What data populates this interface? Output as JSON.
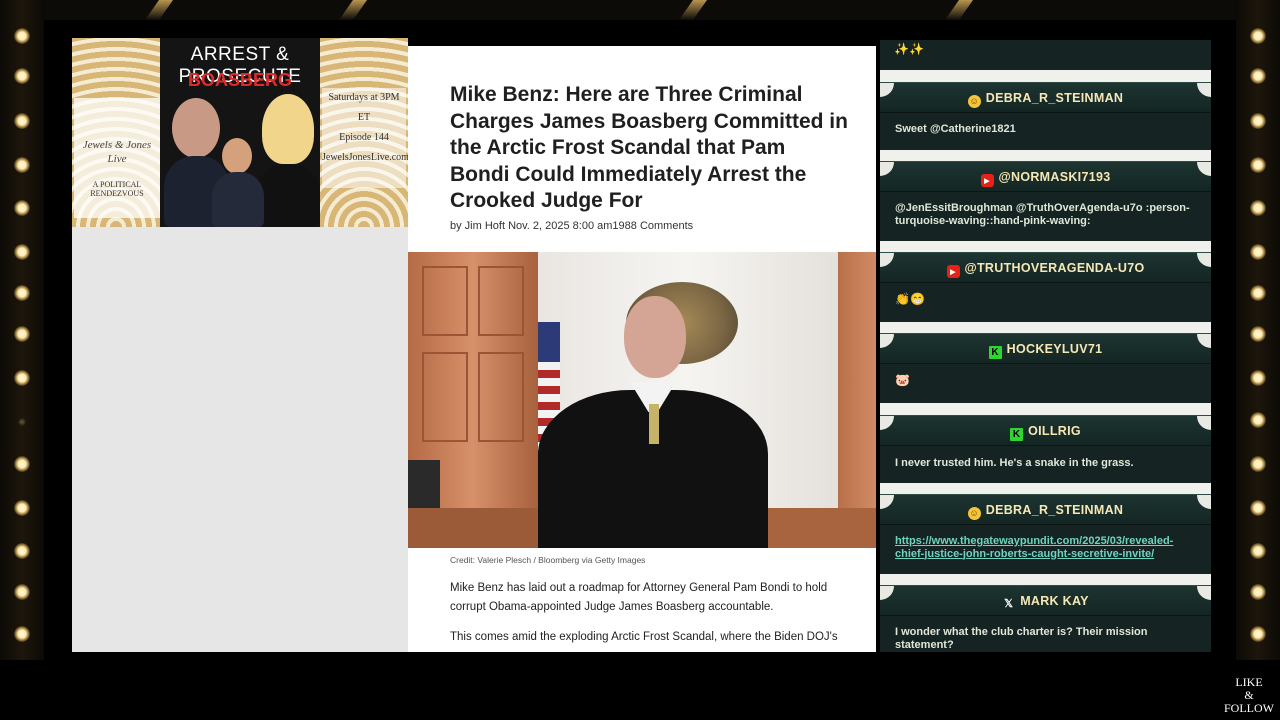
{
  "promo": {
    "title_line1": "ARREST & PROSECUTE",
    "title_line2": "BOASBERG",
    "brand": "Jewels & Jones Live",
    "brand_tagline": "A POLITICAL RENDEZVOUS",
    "schedule": [
      "Saturdays at 3PM ET",
      "Episode 144",
      "JewelsJonesLive.com"
    ]
  },
  "article": {
    "headline": "Mike Benz: Here are Three Criminal Charges James Boasberg Committed in the Arctic Frost Scandal that Pam Bondi Could Immediately Arrest the Crooked Judge For",
    "byline": "by Jim Hoft Nov. 2, 2025 8:00 am1988 Comments",
    "caption": "Credit: Valerie Plesch / Bloomberg via Getty Images",
    "para1": "Mike Benz has laid out a roadmap for Attorney General Pam Bondi to hold corrupt Obama-appointed Judge James Boasberg accountable.",
    "para2": "This comes amid the exploding Arctic Frost Scandal, where the Biden DOJ's"
  },
  "chat": {
    "top_emoji": "✨✨",
    "messages": [
      {
        "platform": "smile-icon",
        "user": "DEBRA_R_STEINMAN",
        "text": "Sweet @Catherine1821"
      },
      {
        "platform": "youtube-icon",
        "user": "@NORMASKI7193",
        "text": "@JenEssitBroughman @TruthOverAgenda-u7o :person-turquoise-waving::hand-pink-waving:"
      },
      {
        "platform": "youtube-icon",
        "user": "@TRUTHOVERAGENDA-U7O",
        "text": "👏😁"
      },
      {
        "platform": "kick-icon",
        "user": "HOCKEYLUV71",
        "text": "🐷"
      },
      {
        "platform": "kick-icon",
        "user": "OILLRIG",
        "text": "I never trusted him. He's a snake in the grass."
      },
      {
        "platform": "smile-icon",
        "user": "DEBRA_R_STEINMAN",
        "text": "https://www.thegatewaypundit.com/2025/03/revealed-chief-justice-john-roberts-caught-secretive-invite/"
      },
      {
        "platform": "x-icon",
        "user": "MARK KAY",
        "text": "I wonder what the club charter is? Their mission statement?"
      }
    ]
  },
  "overlay": {
    "like_follow": [
      "LIKE",
      "&",
      "FOLLOW"
    ]
  }
}
